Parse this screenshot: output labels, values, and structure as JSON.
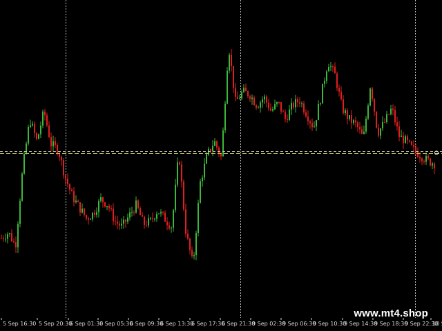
{
  "watermark": "www.mt4.shop",
  "chart_data": {
    "type": "candlestick",
    "instrument": "",
    "timeframe": "M15",
    "colors": {
      "background": "#000000",
      "bull": "#3CB83C",
      "bear": "#E02020",
      "grid": "#D8D8D8",
      "bid_line": "#D8D8D8",
      "ask_line": "#C8C850",
      "axis_text": "#D8D8D8"
    },
    "grid": true,
    "x_ticks": [
      "5 Sep 16:30",
      "5 Sep 20:30",
      "6 Sep 01:30",
      "6 Sep 05:30",
      "6 Sep 09:30",
      "6 Sep 13:30",
      "6 Sep 17:30",
      "6 Sep 21:30",
      "9 Sep 02:30",
      "9 Sep 06:30",
      "9 Sep 10:30",
      "9 Sep 14:30",
      "9 Sep 18:30",
      "9 Sep 22:30",
      "10 Sep"
    ],
    "x_ticks_partial_left": "0",
    "close_profile": [
      0.2,
      0.22,
      0.17,
      0.45,
      0.63,
      0.55,
      0.66,
      0.54,
      0.52,
      0.42,
      0.35,
      0.31,
      0.27,
      0.29,
      0.34,
      0.32,
      0.26,
      0.24,
      0.28,
      0.32,
      0.25,
      0.26,
      0.3,
      0.27,
      0.24,
      0.51,
      0.22,
      0.1,
      0.4,
      0.5,
      0.55,
      0.49,
      0.9,
      0.69,
      0.73,
      0.72,
      0.68,
      0.71,
      0.66,
      0.69,
      0.63,
      0.68,
      0.7,
      0.65,
      0.6,
      0.71,
      0.84,
      0.79,
      0.67,
      0.63,
      0.61,
      0.56,
      0.76,
      0.58,
      0.62,
      0.67,
      0.57,
      0.55,
      0.52,
      0.5,
      0.48,
      0.47
    ],
    "last_price_level": 0.51
  }
}
